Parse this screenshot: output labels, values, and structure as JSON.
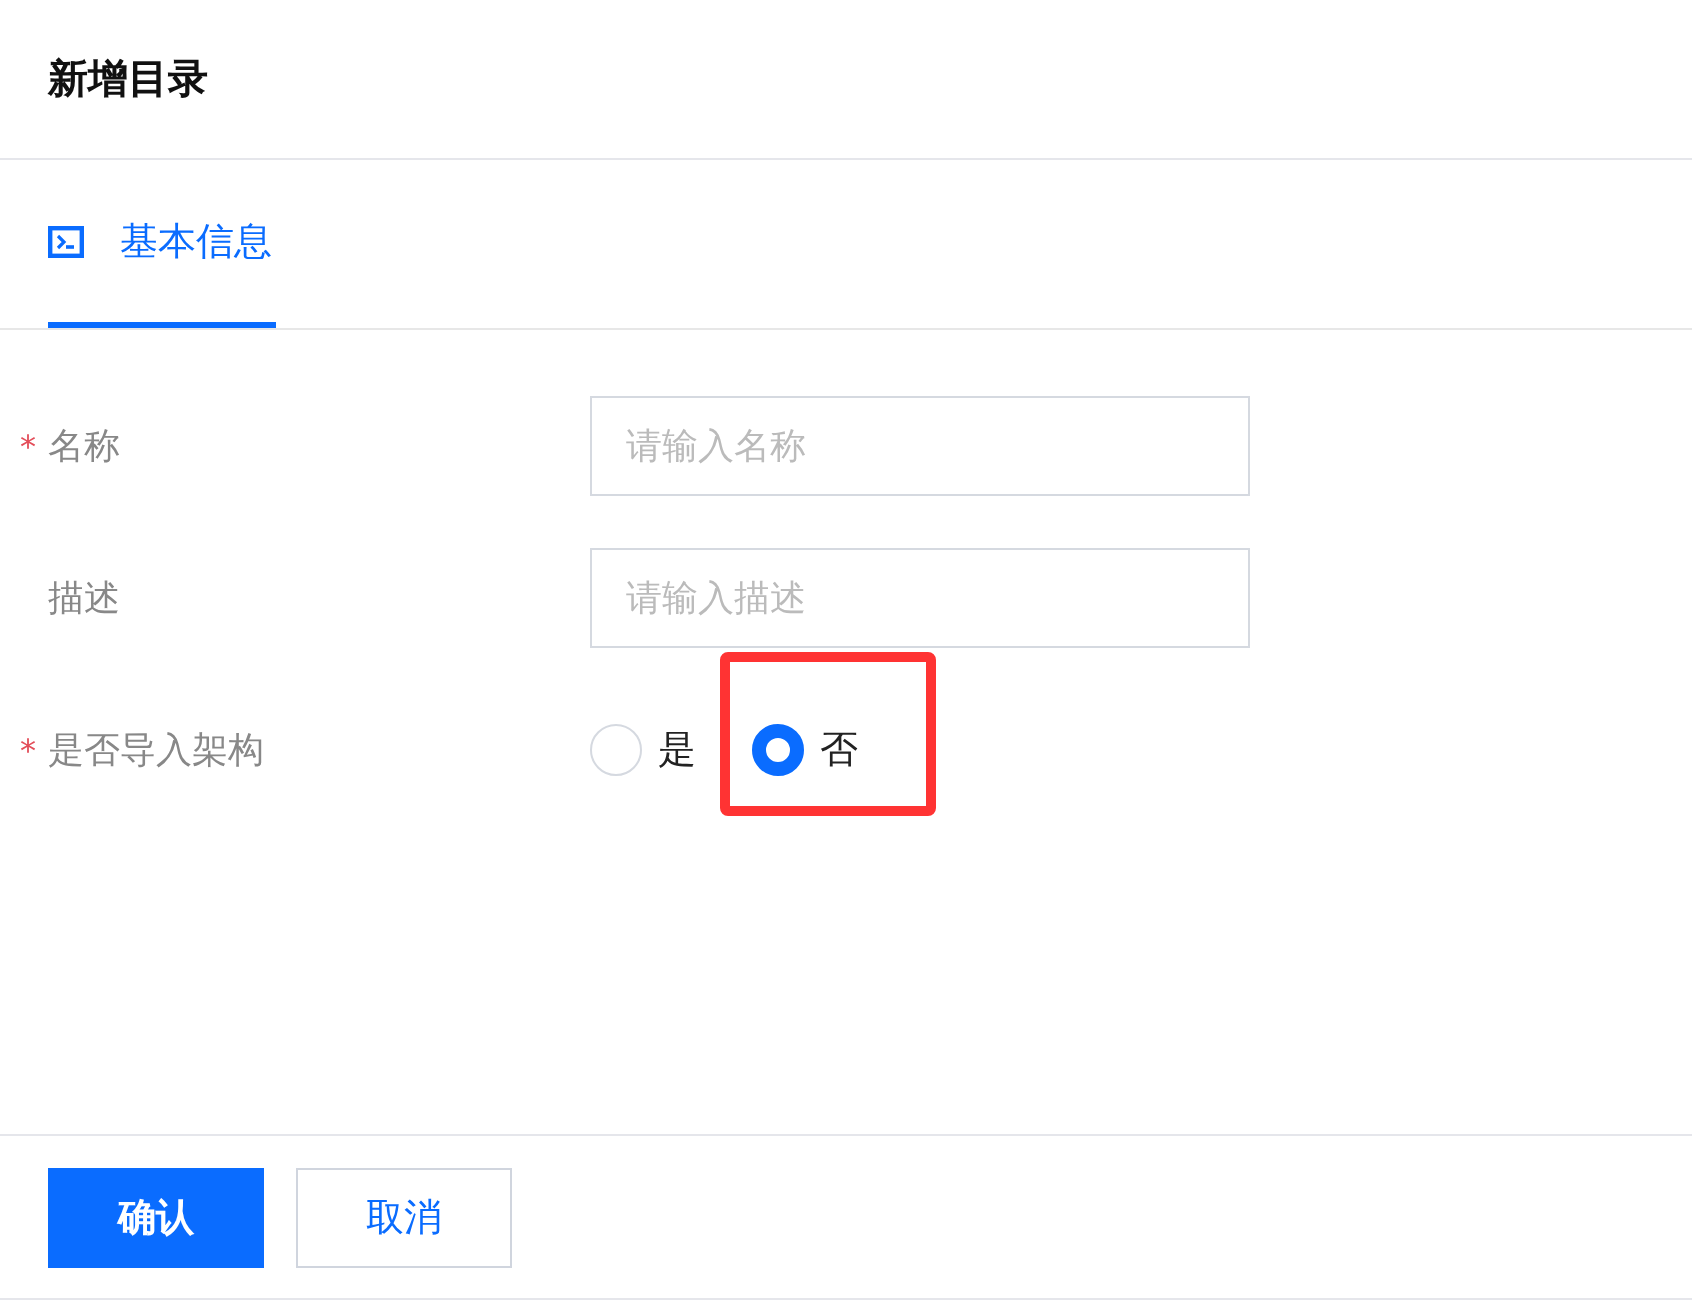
{
  "dialog": {
    "title": "新增目录"
  },
  "tabs": [
    {
      "label": "基本信息",
      "selected": true
    }
  ],
  "fields": [
    {
      "kind": "input",
      "required_mark": "*",
      "label": "名称",
      "placeholder": "请输入名称"
    },
    {
      "kind": "input",
      "label": "描述",
      "placeholder": "请输入描述"
    },
    {
      "kind": "radio",
      "required_mark": "*",
      "label": "是否导入架构",
      "options": [
        {
          "label": "是",
          "selected": false,
          "highlighted": false
        },
        {
          "label": "否",
          "selected": true,
          "highlighted": true
        }
      ]
    }
  ],
  "buttons": [
    {
      "label": "确认",
      "kind": "primary"
    },
    {
      "label": "取消",
      "kind": "secondary"
    }
  ]
}
